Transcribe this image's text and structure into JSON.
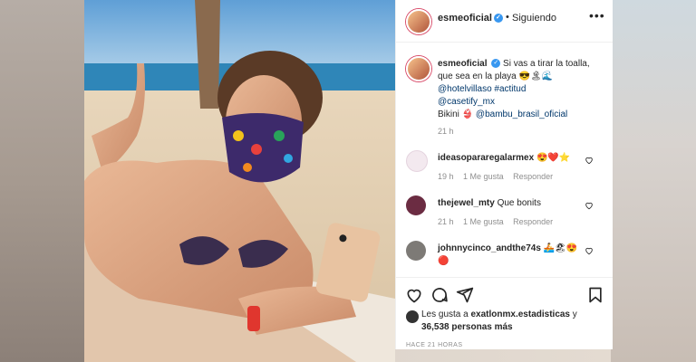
{
  "post": {
    "username": "esmeoficial",
    "verified_glyph": "✓",
    "separator": "•",
    "follow_status": "Siguiendo",
    "more_glyph": "•••"
  },
  "caption": {
    "username": "esmeoficial",
    "text_line1": "Si vas a tirar la toalla,",
    "text_line2": "que sea en la playa 😎🏝🌊",
    "mention_hotel": "@hotelvillaso",
    "hashtag": "#actitud",
    "mention_case": "@casetify_mx",
    "bikini_label": "Bikini 👙",
    "mention_bambu": "@bambu_brasil_oficial",
    "time": "21 h"
  },
  "comments": [
    {
      "username": "ideasopararegalarmex",
      "text": "😍❤️⭐",
      "time": "19 h",
      "likes": "1 Me gusta",
      "reply": "Responder"
    },
    {
      "username": "thejewel_mty",
      "text": "Que bonits",
      "time": "21 h",
      "likes": "1 Me gusta",
      "reply": "Responder"
    },
    {
      "username": "johnnycinco_andthe74s",
      "text": "🚣🏖😍",
      "text2": "🔴",
      "time": "",
      "likes": "",
      "reply": ""
    }
  ],
  "likes": {
    "prefix": "Les gusta a",
    "user": "exatlonmx.estadisticas",
    "conj": "y",
    "count": "36,538 personas más"
  },
  "posted_ago": "HACE 21 HORAS",
  "icons": [
    "heart-icon",
    "comment-icon",
    "share-icon",
    "bookmark-icon"
  ],
  "colors": {
    "verified": "#3897f0",
    "link": "#00376b",
    "muted": "#8e8e8e"
  }
}
